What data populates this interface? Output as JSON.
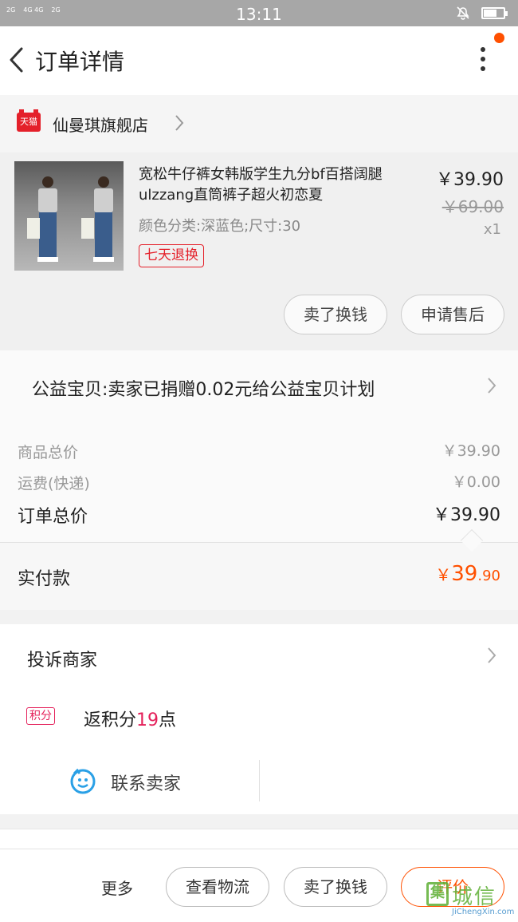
{
  "status_bar": {
    "signal_left": "2G",
    "signal_mid": "4G 4G",
    "signal_right": "2G",
    "time": "13:11"
  },
  "header": {
    "title": "订单详情"
  },
  "shop": {
    "badge": "天猫",
    "name": "仙曼琪旗舰店"
  },
  "product": {
    "title": "宽松牛仔裤女韩版学生九分bf百搭阔腿ulzzang直筒裤子超火初恋夏",
    "attributes": "颜色分类:深蓝色;尺寸:30",
    "return_badge": "七天退换",
    "price": "￥39.90",
    "original_price": "￥69.00",
    "quantity": "x1",
    "sell_button": "卖了换钱",
    "aftersale_button": "申请售后"
  },
  "charity": {
    "text": "公益宝贝:卖家已捐赠0.02元给公益宝贝计划"
  },
  "summary": {
    "goods_total_label": "商品总价",
    "goods_total_value": "￥39.90",
    "shipping_label": "运费(快递)",
    "shipping_value": "￥0.00",
    "order_total_label": "订单总价",
    "order_total_value": "￥39.90",
    "paid_label": "实付款",
    "paid_currency": "￥",
    "paid_int": "39",
    "paid_cents": ".90"
  },
  "actions": {
    "complain": "投诉商家",
    "points_badge": "积分",
    "points_prefix": "返积分",
    "points_value": "19",
    "points_suffix": "点",
    "contact_seller": "联系卖家"
  },
  "bottom_bar": {
    "more": "更多",
    "logistics": "查看物流",
    "sell": "卖了换钱",
    "review": "评价"
  },
  "watermark": {
    "logo_char": "集",
    "name": "城信",
    "site": "JiChengXin.com"
  },
  "colors": {
    "accent": "#ff5000",
    "tmall_red": "#e4202a",
    "points_pink": "#e4205a"
  }
}
